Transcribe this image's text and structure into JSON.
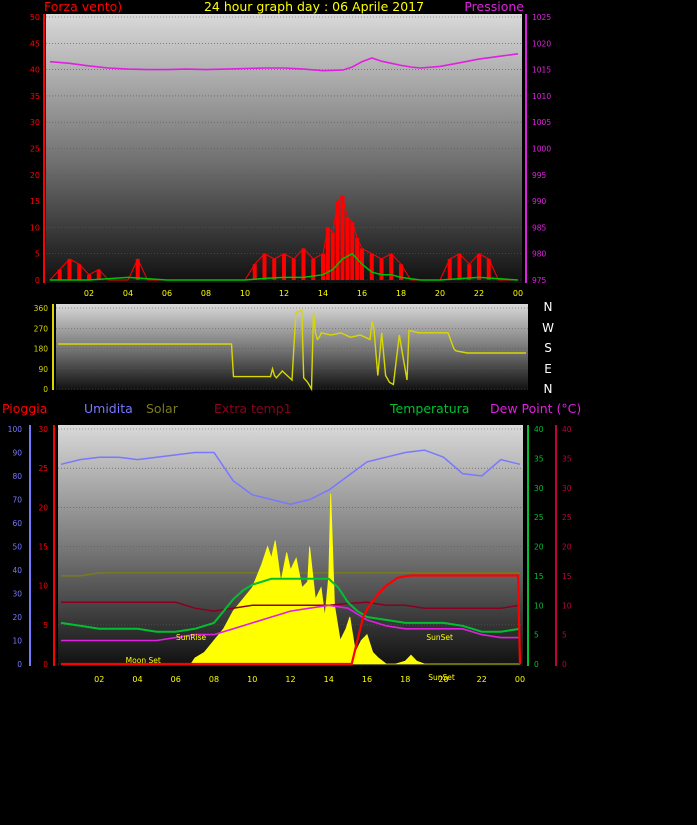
{
  "colors": {
    "wind": "#ff0000",
    "gust_fill": "#ff0000",
    "wind_avg": "#00c000",
    "pressure": "#e020e0",
    "direction": "#d8d800",
    "humidity": "#7878ff",
    "solar": "#ffff00",
    "solar_ref": "#7a7a1e",
    "extra_temp": "#8a0020",
    "temperature": "#00c030",
    "dew_point": "#e020e0",
    "rain": "#ff0000",
    "text_title": "#ffff00",
    "axis_left": "#ff0000",
    "axis_press": "#e020e0",
    "axis_temp": "#00c030",
    "axis_dew": "#c00040",
    "axis_hum": "#7878ff",
    "grid": "#555555"
  },
  "chart_data": [
    {
      "type": "line",
      "id": "wind_pressure",
      "title": "24 hour graph day : 06 Aprile 2017",
      "left_label": "Forza vento)",
      "right_label": "Pressione",
      "x_ticks": [
        "02",
        "04",
        "06",
        "08",
        "10",
        "12",
        "14",
        "16",
        "18",
        "20",
        "22",
        "00"
      ],
      "y_left_ticks": [
        0,
        5,
        10,
        15,
        20,
        25,
        30,
        35,
        40,
        45,
        50
      ],
      "y_left_range": [
        0,
        50
      ],
      "y_right_ticks": [
        975,
        980,
        985,
        990,
        995,
        1000,
        1005,
        1010,
        1015,
        1020,
        1025
      ],
      "y_right_range": [
        975,
        1025
      ],
      "x_range": [
        0,
        24
      ],
      "series": [
        {
          "name": "pressure",
          "axis": "right",
          "x": [
            0,
            1,
            2,
            3,
            4,
            5,
            6,
            7,
            8,
            9,
            10,
            11,
            12,
            13,
            14,
            15,
            15.5,
            16,
            16.5,
            17,
            17.5,
            18,
            18.5,
            19,
            20,
            21,
            22,
            23,
            24
          ],
          "y": [
            1016.5,
            1016.2,
            1015.7,
            1015.3,
            1015.1,
            1015,
            1015,
            1015.1,
            1015,
            1015.1,
            1015.2,
            1015.3,
            1015.3,
            1015.1,
            1014.8,
            1014.9,
            1015.5,
            1016.5,
            1017.2,
            1016.6,
            1016.2,
            1015.8,
            1015.5,
            1015.3,
            1015.6,
            1016.3,
            1017,
            1017.5,
            1018
          ]
        },
        {
          "name": "wind",
          "axis": "left",
          "x": [
            0,
            0.5,
            1,
            1.5,
            2,
            2.5,
            3,
            3.5,
            4,
            4.5,
            5,
            5.5,
            6,
            6.5,
            7,
            7.5,
            8,
            8.5,
            9,
            9.5,
            10,
            10.5,
            11,
            11.5,
            12,
            12.5,
            13,
            13.5,
            14,
            14.25,
            14.5,
            14.75,
            15,
            15.25,
            15.5,
            15.75,
            16,
            16.5,
            17,
            17.5,
            18,
            18.5,
            19,
            19.5,
            20,
            20.5,
            21,
            21.5,
            22,
            22.5,
            23,
            23.5,
            24
          ],
          "y": [
            0,
            2,
            4,
            3,
            1,
            2,
            0,
            0,
            0,
            4,
            0,
            0,
            0,
            0,
            0,
            0,
            0,
            0,
            0,
            0,
            0,
            3,
            5,
            4,
            5,
            4,
            6,
            4,
            5,
            10,
            9,
            15,
            16,
            12,
            11,
            8,
            6,
            5,
            4,
            5,
            3,
            0,
            0,
            0,
            0,
            4,
            5,
            3,
            5,
            4,
            0,
            0,
            0
          ]
        },
        {
          "name": "wind_avg",
          "axis": "left",
          "x": [
            0,
            2,
            4,
            6,
            8,
            10,
            11,
            12,
            13,
            14,
            14.5,
            15,
            15.5,
            16,
            16.5,
            17,
            17.5,
            18,
            19,
            20,
            22,
            24
          ],
          "y": [
            0,
            0,
            0.5,
            0,
            0,
            0,
            0.3,
            0.5,
            0.5,
            1,
            2,
            4,
            5,
            3,
            1.5,
            1,
            1,
            0.5,
            0,
            0,
            0.5,
            0
          ]
        }
      ]
    },
    {
      "type": "line",
      "id": "wind_direction",
      "y_ticks": [
        0,
        90,
        180,
        270,
        360
      ],
      "y_range": [
        0,
        360
      ],
      "x_range": [
        0,
        24
      ],
      "compass": [
        "N",
        "W",
        "S",
        "E",
        "N"
      ],
      "series": [
        {
          "name": "direction",
          "x": [
            0,
            8.9,
            9,
            10.9,
            11,
            11.1,
            11.2,
            11.5,
            12,
            12.2,
            12.5,
            12.6,
            12.8,
            13,
            13.1,
            13.2,
            13.3,
            13.4,
            13.5,
            14,
            14.5,
            15,
            15.5,
            16,
            16.1,
            16.2,
            16.4,
            16.6,
            16.8,
            17,
            17.2,
            17.5,
            17.9,
            18,
            18.5,
            19,
            19.5,
            20,
            20.3,
            20.4,
            21,
            21.5,
            22,
            24
          ],
          "y": [
            200,
            200,
            55,
            55,
            90,
            60,
            50,
            80,
            40,
            340,
            350,
            50,
            30,
            0,
            340,
            250,
            220,
            230,
            250,
            240,
            250,
            230,
            240,
            220,
            300,
            270,
            60,
            250,
            60,
            30,
            20,
            240,
            40,
            260,
            250,
            250,
            250,
            250,
            180,
            170,
            160,
            160,
            160,
            160
          ]
        }
      ]
    },
    {
      "type": "line",
      "id": "weather_detail",
      "legend": [
        "Pioggia",
        "Umidita",
        "Solar",
        "Extra temp1",
        "Temperatura",
        "Dew Point (°C)"
      ],
      "x_ticks": [
        "02",
        "04",
        "06",
        "08",
        "10",
        "12",
        "14",
        "16",
        "18",
        "20",
        "22",
        "00"
      ],
      "x_range": [
        0,
        24
      ],
      "y_hum_ticks": [
        0,
        10,
        20,
        30,
        40,
        50,
        60,
        70,
        80,
        90,
        100
      ],
      "y_rain_ticks": [
        0,
        5,
        10,
        15,
        20,
        25,
        30
      ],
      "y_temp_ticks": [
        0,
        5,
        10,
        15,
        20,
        25,
        30,
        35,
        40
      ],
      "y_dew_ticks": [
        0,
        5,
        10,
        15,
        20,
        25,
        30,
        35,
        40
      ],
      "annotations": [
        "SunRise",
        "SunSet",
        "Moon Set",
        "SunSet"
      ],
      "series": [
        {
          "name": "Umidita",
          "axis": "hum",
          "x": [
            0,
            1,
            2,
            3,
            4,
            5,
            6,
            7,
            8,
            9,
            10,
            11,
            12,
            13,
            14,
            15,
            16,
            17,
            18,
            19,
            20,
            21,
            22,
            23,
            24
          ],
          "y": [
            85,
            87,
            88,
            88,
            87,
            88,
            89,
            90,
            90,
            78,
            72,
            70,
            68,
            70,
            74,
            80,
            86,
            88,
            90,
            91,
            88,
            81,
            80,
            87,
            85
          ]
        },
        {
          "name": "Solar",
          "axis": "temp",
          "x": [
            0,
            1,
            2,
            3,
            4,
            5,
            6,
            7,
            8,
            9,
            10,
            11,
            12,
            13,
            14,
            15,
            16,
            17,
            18,
            19,
            20,
            21,
            22,
            23,
            24
          ],
          "y": [
            15,
            15,
            15.5,
            15.5,
            15.5,
            15.5,
            15.5,
            15.5,
            15.5,
            15.5,
            15.5,
            15.5,
            15.5,
            15.5,
            15.5,
            15.5,
            15.5,
            15.5,
            15.5,
            15.5,
            15.5,
            15.5,
            15.5,
            15.5,
            15.5
          ]
        },
        {
          "name": "Solar_radiation",
          "axis": "temp",
          "x": [
            0,
            6.8,
            7,
            7.5,
            8,
            8.5,
            9,
            9.5,
            10,
            10.5,
            10.8,
            11,
            11.2,
            11.5,
            11.8,
            12,
            12.3,
            12.6,
            12.9,
            13,
            13.3,
            13.6,
            13.8,
            14,
            14.1,
            14.3,
            14.6,
            14.9,
            15.1,
            15.4,
            15.7,
            16,
            16.3,
            16.6,
            17,
            17.5,
            18,
            18.3,
            18.6,
            19,
            19.5,
            20,
            24
          ],
          "y": [
            0,
            0,
            1,
            2,
            4,
            6,
            9,
            11,
            13,
            17,
            20,
            18,
            21,
            14,
            19,
            16,
            18,
            13,
            14,
            20,
            11,
            13,
            8,
            15,
            29,
            10,
            4,
            6,
            8,
            2,
            4,
            5,
            2,
            1,
            0,
            0,
            0.5,
            1.5,
            0.5,
            0,
            0,
            0,
            0
          ]
        },
        {
          "name": "Extra temp1",
          "axis": "temp",
          "x": [
            0,
            2,
            4,
            6,
            7,
            8,
            9,
            10,
            11,
            12,
            13,
            14,
            15,
            16,
            17,
            18,
            19,
            20,
            21,
            22,
            23,
            24
          ],
          "y": [
            10.5,
            10.5,
            10.5,
            10.5,
            9.5,
            9,
            9.5,
            10,
            10,
            10,
            10,
            10,
            10.3,
            10.5,
            10,
            10,
            9.5,
            9.5,
            9.5,
            9.5,
            9.5,
            10
          ]
        },
        {
          "name": "Temperatura",
          "axis": "temp",
          "x": [
            0,
            1,
            2,
            3,
            4,
            5,
            6,
            7,
            8,
            8.5,
            9,
            9.5,
            10,
            11,
            12,
            13,
            14,
            14.5,
            15,
            15.5,
            16,
            17,
            18,
            19,
            20,
            21,
            22,
            23,
            24
          ],
          "y": [
            7,
            6.5,
            6,
            6,
            6,
            5.5,
            5.5,
            6,
            7,
            9,
            11,
            12.5,
            13.5,
            14.5,
            14.5,
            14.5,
            14.5,
            13,
            10.5,
            9,
            8,
            7.5,
            7,
            7,
            7,
            6.5,
            5.5,
            5.5,
            6
          ]
        },
        {
          "name": "Dew Point (°C)",
          "axis": "dew",
          "x": [
            0,
            1,
            2,
            3,
            4,
            5,
            6,
            7,
            8,
            9,
            10,
            11,
            12,
            13,
            14,
            15,
            15.5,
            16,
            17,
            18,
            19,
            20,
            21,
            22,
            23,
            24
          ],
          "y": [
            4,
            4,
            4,
            4,
            4,
            4,
            4.5,
            5,
            5,
            6,
            7,
            8,
            9,
            9.5,
            10,
            9.5,
            8.5,
            7.5,
            6.5,
            6,
            6,
            6,
            6,
            5,
            4.5,
            4.5
          ]
        },
        {
          "name": "Pioggia",
          "axis": "rain",
          "x": [
            0,
            15.2,
            15.4,
            15.6,
            15.8,
            16,
            16.3,
            16.6,
            17,
            17.3,
            17.6,
            18,
            18.3,
            20,
            22,
            23.9,
            24
          ],
          "y": [
            0,
            0,
            2,
            4,
            6,
            7,
            8,
            9,
            10,
            10.5,
            11,
            11.2,
            11.3,
            11.3,
            11.3,
            11.3,
            0
          ]
        }
      ]
    }
  ]
}
